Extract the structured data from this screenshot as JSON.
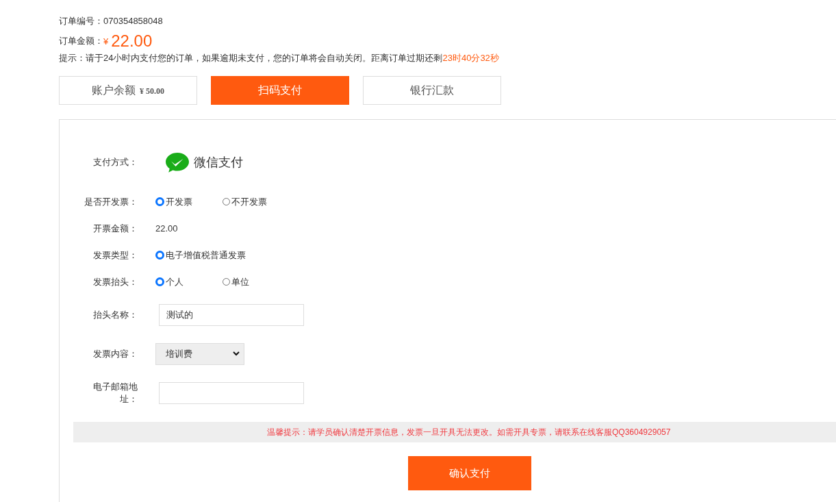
{
  "order": {
    "number_label": "订单编号：",
    "number": "070354858048",
    "amount_label": "订单金额：",
    "currency": "¥",
    "amount": "22.00",
    "hint": "提示：请于24小时内支付您的订单，如果逾期未支付，您的订单将会自动关闭。距离订单过期还剩",
    "countdown": "23时40分32秒"
  },
  "tabs": [
    {
      "label": "账户余额",
      "sub": "¥ 50.00",
      "selected": false
    },
    {
      "label": "扫码支付",
      "selected": true
    },
    {
      "label": "银行汇款",
      "selected": false
    }
  ],
  "payment": {
    "label": "支付方式：",
    "method": "微信支付"
  },
  "rows": [
    {
      "kind": "radio",
      "label": "是否开发票：",
      "options": [
        {
          "label": "开发票",
          "selected": true
        },
        {
          "label": "不开发票",
          "selected": false
        }
      ]
    },
    {
      "kind": "text",
      "label": "开票金额：",
      "value": "22.00"
    },
    {
      "kind": "radio",
      "label": "发票类型：",
      "options": [
        {
          "label": "电子增值税普通发票",
          "selected": true
        }
      ]
    },
    {
      "kind": "radio",
      "label": "发票抬头：",
      "options": [
        {
          "label": "个人",
          "selected": true
        },
        {
          "label": "单位",
          "selected": false
        }
      ]
    },
    {
      "kind": "input",
      "label": "抬头名称：",
      "value": "测试的"
    },
    {
      "kind": "select",
      "label": "发票内容：",
      "value": "培训费"
    },
    {
      "kind": "input",
      "label": "电子邮箱地址："
    }
  ],
  "notice": "温馨提示：请学员确认清楚开票信息，发票一旦开具无法更改。如需开具专票，请联系在线客服QQ3604929057",
  "confirm": "确认支付"
}
